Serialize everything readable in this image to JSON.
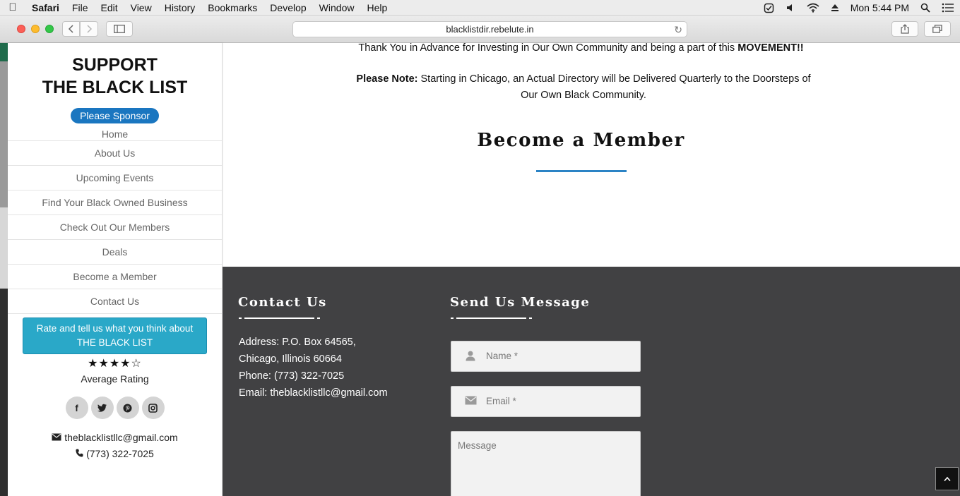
{
  "menubar": {
    "app": "Safari",
    "items": [
      "File",
      "Edit",
      "View",
      "History",
      "Bookmarks",
      "Develop",
      "Window",
      "Help"
    ],
    "clock": "Mon 5:44 PM"
  },
  "browser": {
    "url": "blacklistdir.rebelute.in"
  },
  "sidebar": {
    "title_line1": "SUPPORT",
    "title_line2": "THE BLACK LIST",
    "sponsor_button": "Please Sponsor",
    "nav": [
      "Home",
      "About Us",
      "Upcoming Events",
      "Find Your Black Owned Business",
      "Check Out Our Members",
      "Deals",
      "Become a Member",
      "Contact Us"
    ],
    "rate_button_line1": "Rate and tell us what you think about",
    "rate_button_line2": "THE BLACK LIST",
    "stars": "★★★★☆",
    "rating": 4,
    "rating_max": 5,
    "average_rating_label": "Average Rating",
    "email": "theblacklistllc@gmail.com",
    "phone": "(773) 322-7025"
  },
  "main": {
    "para1_text": "Thank You in Advance for Investing in Our Own Community and being a part of this ",
    "para1_bold": "MOVEMENT!!",
    "para2_bold": "Please Note:",
    "para2_text": " Starting in Chicago, an Actual Directory will be Delivered Quarterly to the Doorsteps of Our Own Black Community.",
    "section_title": "Become a Member"
  },
  "footer": {
    "contact_heading": "Contact Us",
    "address_line1": "Address: P.O. Box 64565,",
    "address_line2": "Chicago, Illinois 60664",
    "phone_line": "Phone: (773) 322-7025",
    "email_line": "Email: theblacklistllc@gmail.com",
    "message_heading": "Send Us Message",
    "name_placeholder": "Name *",
    "email_placeholder": "Email *",
    "message_placeholder": "Message"
  },
  "colors": {
    "sponsor_button": "#1a76c0",
    "rate_button": "#2aa8c8",
    "accent_line": "#2b83c5",
    "footer_bg": "#414143"
  }
}
